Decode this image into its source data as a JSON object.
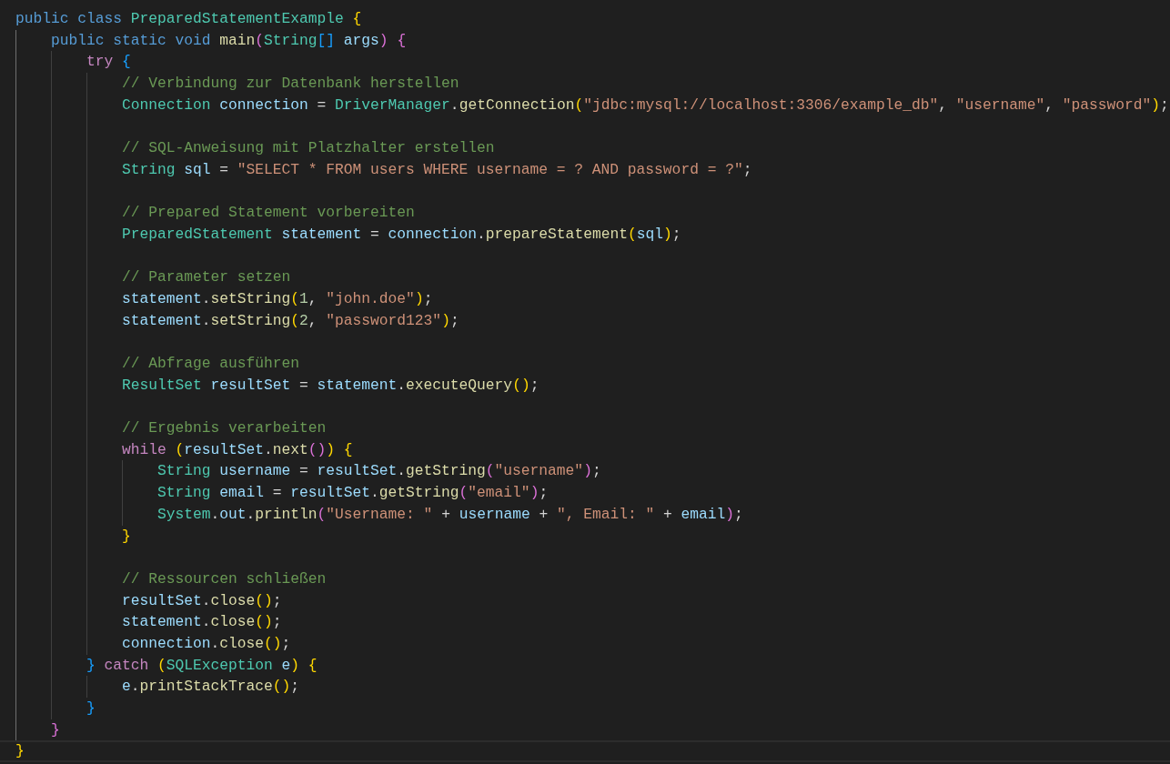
{
  "editor": {
    "lines": [
      {
        "current": false,
        "tokens": [
          {
            "kind": "keyword",
            "text": "public class "
          },
          {
            "kind": "type",
            "text": "PreparedStatementExample "
          },
          {
            "kind": "bracket1",
            "text": "{"
          }
        ]
      },
      {
        "current": false,
        "tokens": [
          {
            "kind": "keyword",
            "text": "    public static void "
          },
          {
            "kind": "func",
            "text": "main"
          },
          {
            "kind": "bracket2",
            "text": "("
          },
          {
            "kind": "type",
            "text": "String"
          },
          {
            "kind": "bracket3",
            "text": "[]"
          },
          {
            "kind": "var",
            "text": " args"
          },
          {
            "kind": "bracket2",
            "text": ") "
          },
          {
            "kind": "bracket2",
            "text": "{"
          }
        ]
      },
      {
        "current": false,
        "tokens": [
          {
            "kind": "control",
            "text": "        try "
          },
          {
            "kind": "bracket3",
            "text": "{"
          }
        ]
      },
      {
        "current": false,
        "tokens": [
          {
            "kind": "comment",
            "text": "            // Verbindung zur Datenbank herstellen"
          }
        ]
      },
      {
        "current": false,
        "tokens": [
          {
            "kind": "type",
            "text": "            Connection "
          },
          {
            "kind": "var",
            "text": "connection"
          },
          {
            "kind": "plain",
            "text": " = "
          },
          {
            "kind": "type",
            "text": "DriverManager"
          },
          {
            "kind": "plain",
            "text": "."
          },
          {
            "kind": "func",
            "text": "getConnection"
          },
          {
            "kind": "bracket1",
            "text": "("
          },
          {
            "kind": "string",
            "text": "\"jdbc:mysql://localhost:3306/example_db\""
          },
          {
            "kind": "plain",
            "text": ", "
          },
          {
            "kind": "string",
            "text": "\"username\""
          },
          {
            "kind": "plain",
            "text": ", "
          },
          {
            "kind": "string",
            "text": "\"password\""
          },
          {
            "kind": "bracket1",
            "text": ")"
          },
          {
            "kind": "plain",
            "text": ";"
          }
        ]
      },
      {
        "current": false
      },
      {
        "current": false,
        "tokens": [
          {
            "kind": "comment",
            "text": "            // SQL-Anweisung mit Platzhalter erstellen"
          }
        ]
      },
      {
        "current": false,
        "tokens": [
          {
            "kind": "type",
            "text": "            String "
          },
          {
            "kind": "var",
            "text": "sql"
          },
          {
            "kind": "plain",
            "text": " = "
          },
          {
            "kind": "string",
            "text": "\"SELECT * FROM users WHERE username = ? AND password = ?\""
          },
          {
            "kind": "plain",
            "text": ";"
          }
        ]
      },
      {
        "current": false
      },
      {
        "current": false,
        "tokens": [
          {
            "kind": "comment",
            "text": "            // Prepared Statement vorbereiten"
          }
        ]
      },
      {
        "current": false,
        "tokens": [
          {
            "kind": "type",
            "text": "            PreparedStatement "
          },
          {
            "kind": "var",
            "text": "statement"
          },
          {
            "kind": "plain",
            "text": " = "
          },
          {
            "kind": "var",
            "text": "connection"
          },
          {
            "kind": "plain",
            "text": "."
          },
          {
            "kind": "func",
            "text": "prepareStatement"
          },
          {
            "kind": "bracket1",
            "text": "("
          },
          {
            "kind": "var",
            "text": "sql"
          },
          {
            "kind": "bracket1",
            "text": ")"
          },
          {
            "kind": "plain",
            "text": ";"
          }
        ]
      },
      {
        "current": false
      },
      {
        "current": false,
        "tokens": [
          {
            "kind": "comment",
            "text": "            // Parameter setzen"
          }
        ]
      },
      {
        "current": false,
        "tokens": [
          {
            "kind": "var",
            "text": "            statement"
          },
          {
            "kind": "plain",
            "text": "."
          },
          {
            "kind": "func",
            "text": "setString"
          },
          {
            "kind": "bracket1",
            "text": "("
          },
          {
            "kind": "number",
            "text": "1"
          },
          {
            "kind": "plain",
            "text": ", "
          },
          {
            "kind": "string",
            "text": "\"john.doe\""
          },
          {
            "kind": "bracket1",
            "text": ")"
          },
          {
            "kind": "plain",
            "text": ";"
          }
        ]
      },
      {
        "current": false,
        "tokens": [
          {
            "kind": "var",
            "text": "            statement"
          },
          {
            "kind": "plain",
            "text": "."
          },
          {
            "kind": "func",
            "text": "setString"
          },
          {
            "kind": "bracket1",
            "text": "("
          },
          {
            "kind": "number",
            "text": "2"
          },
          {
            "kind": "plain",
            "text": ", "
          },
          {
            "kind": "string",
            "text": "\"password123\""
          },
          {
            "kind": "bracket1",
            "text": ")"
          },
          {
            "kind": "plain",
            "text": ";"
          }
        ]
      },
      {
        "current": false
      },
      {
        "current": false,
        "tokens": [
          {
            "kind": "comment",
            "text": "            // Abfrage ausführen"
          }
        ]
      },
      {
        "current": false,
        "tokens": [
          {
            "kind": "type",
            "text": "            ResultSet "
          },
          {
            "kind": "var",
            "text": "resultSet"
          },
          {
            "kind": "plain",
            "text": " = "
          },
          {
            "kind": "var",
            "text": "statement"
          },
          {
            "kind": "plain",
            "text": "."
          },
          {
            "kind": "func",
            "text": "executeQuery"
          },
          {
            "kind": "bracket1",
            "text": "()"
          },
          {
            "kind": "plain",
            "text": ";"
          }
        ]
      },
      {
        "current": false
      },
      {
        "current": false,
        "tokens": [
          {
            "kind": "comment",
            "text": "            // Ergebnis verarbeiten"
          }
        ]
      },
      {
        "current": false,
        "tokens": [
          {
            "kind": "control",
            "text": "            while "
          },
          {
            "kind": "bracket1",
            "text": "("
          },
          {
            "kind": "var",
            "text": "resultSet"
          },
          {
            "kind": "plain",
            "text": "."
          },
          {
            "kind": "func",
            "text": "next"
          },
          {
            "kind": "bracket2",
            "text": "()"
          },
          {
            "kind": "bracket1",
            "text": ") "
          },
          {
            "kind": "bracket1",
            "text": "{"
          }
        ]
      },
      {
        "current": false,
        "tokens": [
          {
            "kind": "type",
            "text": "                String "
          },
          {
            "kind": "var",
            "text": "username"
          },
          {
            "kind": "plain",
            "text": " = "
          },
          {
            "kind": "var",
            "text": "resultSet"
          },
          {
            "kind": "plain",
            "text": "."
          },
          {
            "kind": "func",
            "text": "getString"
          },
          {
            "kind": "bracket2",
            "text": "("
          },
          {
            "kind": "string",
            "text": "\"username\""
          },
          {
            "kind": "bracket2",
            "text": ")"
          },
          {
            "kind": "plain",
            "text": ";"
          }
        ]
      },
      {
        "current": false,
        "tokens": [
          {
            "kind": "type",
            "text": "                String "
          },
          {
            "kind": "var",
            "text": "email"
          },
          {
            "kind": "plain",
            "text": " = "
          },
          {
            "kind": "var",
            "text": "resultSet"
          },
          {
            "kind": "plain",
            "text": "."
          },
          {
            "kind": "func",
            "text": "getString"
          },
          {
            "kind": "bracket2",
            "text": "("
          },
          {
            "kind": "string",
            "text": "\"email\""
          },
          {
            "kind": "bracket2",
            "text": ")"
          },
          {
            "kind": "plain",
            "text": ";"
          }
        ]
      },
      {
        "current": false,
        "tokens": [
          {
            "kind": "type",
            "text": "                System"
          },
          {
            "kind": "plain",
            "text": "."
          },
          {
            "kind": "var",
            "text": "out"
          },
          {
            "kind": "plain",
            "text": "."
          },
          {
            "kind": "func",
            "text": "println"
          },
          {
            "kind": "bracket2",
            "text": "("
          },
          {
            "kind": "string",
            "text": "\"Username: \""
          },
          {
            "kind": "plain",
            "text": " + "
          },
          {
            "kind": "var",
            "text": "username"
          },
          {
            "kind": "plain",
            "text": " + "
          },
          {
            "kind": "string",
            "text": "\", Email: \""
          },
          {
            "kind": "plain",
            "text": " + "
          },
          {
            "kind": "var",
            "text": "email"
          },
          {
            "kind": "bracket2",
            "text": ")"
          },
          {
            "kind": "plain",
            "text": ";"
          }
        ]
      },
      {
        "current": false,
        "tokens": [
          {
            "kind": "bracket1",
            "text": "            }"
          }
        ]
      },
      {
        "current": false
      },
      {
        "current": false,
        "tokens": [
          {
            "kind": "comment",
            "text": "            // Ressourcen schließen"
          }
        ]
      },
      {
        "current": false,
        "tokens": [
          {
            "kind": "var",
            "text": "            resultSet"
          },
          {
            "kind": "plain",
            "text": "."
          },
          {
            "kind": "func",
            "text": "close"
          },
          {
            "kind": "bracket1",
            "text": "()"
          },
          {
            "kind": "plain",
            "text": ";"
          }
        ]
      },
      {
        "current": false,
        "tokens": [
          {
            "kind": "var",
            "text": "            statement"
          },
          {
            "kind": "plain",
            "text": "."
          },
          {
            "kind": "func",
            "text": "close"
          },
          {
            "kind": "bracket1",
            "text": "()"
          },
          {
            "kind": "plain",
            "text": ";"
          }
        ]
      },
      {
        "current": false,
        "tokens": [
          {
            "kind": "var",
            "text": "            connection"
          },
          {
            "kind": "plain",
            "text": "."
          },
          {
            "kind": "func",
            "text": "close"
          },
          {
            "kind": "bracket1",
            "text": "()"
          },
          {
            "kind": "plain",
            "text": ";"
          }
        ]
      },
      {
        "current": false,
        "tokens": [
          {
            "kind": "bracket3",
            "text": "        } "
          },
          {
            "kind": "control",
            "text": "catch "
          },
          {
            "kind": "bracket1",
            "text": "("
          },
          {
            "kind": "type",
            "text": "SQLException "
          },
          {
            "kind": "var",
            "text": "e"
          },
          {
            "kind": "bracket1",
            "text": ") "
          },
          {
            "kind": "bracket1",
            "text": "{"
          }
        ]
      },
      {
        "current": false,
        "tokens": [
          {
            "kind": "var",
            "text": "            e"
          },
          {
            "kind": "plain",
            "text": "."
          },
          {
            "kind": "func",
            "text": "printStackTrace"
          },
          {
            "kind": "bracket1",
            "text": "()"
          },
          {
            "kind": "plain",
            "text": ";"
          }
        ]
      },
      {
        "current": false,
        "tokens": [
          {
            "kind": "bracket3",
            "text": "        }"
          }
        ]
      },
      {
        "current": false,
        "tokens": [
          {
            "kind": "bracket2",
            "text": "    }"
          }
        ]
      },
      {
        "current": true,
        "tokens": [
          {
            "kind": "bracket1",
            "text": "}"
          }
        ]
      }
    ]
  }
}
